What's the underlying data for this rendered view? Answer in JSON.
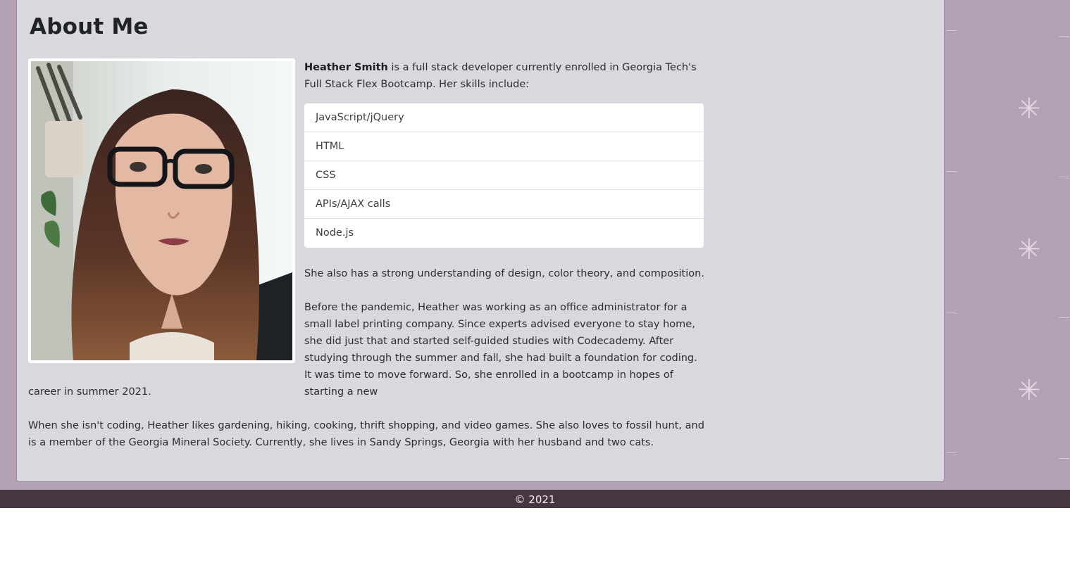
{
  "about": {
    "title": "About Me",
    "intro_name": "Heather Smith",
    "intro_text": " is a full stack developer currently enrolled in Georgia Tech's Full Stack Flex Bootcamp. Her skills include:",
    "skills": [
      "JavaScript/jQuery",
      "HTML",
      "CSS",
      "APIs/AJAX calls",
      "Node.js"
    ],
    "design_text": "She also has a strong understanding of design, color theory, and composition.",
    "before_text": "Before the pandemic, Heather was working as an office administrator for a small label printing company. Since experts advised everyone to stay home, she did just that and started self-guided studies with Codecademy. After studying through the summer and fall, she had built a foundation for coding. It was time to move forward. So, she enrolled in a bootcamp in hopes of starting a new",
    "before_tail": "career in summer 2021.",
    "hobbies_text": "When she isn't coding, Heather likes gardening, hiking, cooking, thrift shopping, and video games. She also loves to fossil hunt, and is a member of the Georgia Mineral Society. Currently, she lives in Sandy Springs, Georgia with her husband and two cats."
  },
  "footer": {
    "copyright": "© 2021"
  },
  "colors": {
    "page_background": "#b4a2b4",
    "card_background": "#d7d9de",
    "footer_background": "#473542"
  },
  "icons": {
    "sparkle": "sparkle-icon"
  }
}
